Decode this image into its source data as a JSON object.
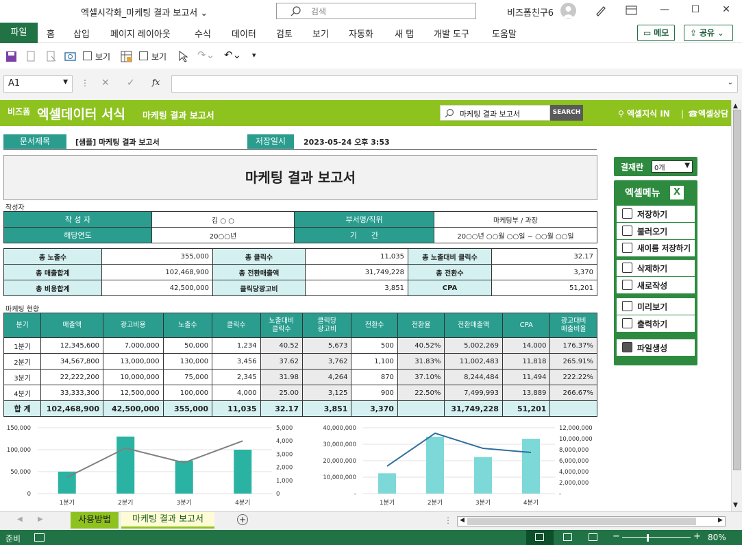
{
  "window": {
    "doc_title": "엑셀시각화_마케팅 결과 보고서",
    "search_placeholder": "검색",
    "user_name": "비즈폼친구6"
  },
  "ribbon": {
    "tabs": [
      "홈",
      "삽입",
      "페이지 레이아웃",
      "수식",
      "데이터",
      "검토",
      "보기",
      "자동화",
      "새 탭",
      "개발 도구",
      "도움말"
    ],
    "file_tab": "파일",
    "memo": "메모",
    "share": "공유"
  },
  "qat": {
    "view1": "보기",
    "view2": "보기"
  },
  "formula_bar": {
    "name_box": "A1",
    "fx": "fx"
  },
  "banner": {
    "brand_small": "비즈폼",
    "brand_big": "엑셀데이터 서식",
    "subtitle": "마케팅 결과 보고서",
    "search_value": "마케팅 결과 보고서",
    "search_button": "SEARCH",
    "link_knowledge": "엑셀지식 IN",
    "link_consult": "엑셀상담"
  },
  "doc_info": {
    "title_label": "문서제목",
    "title_value": "[샘플] 마케팅 결과 보고서",
    "saved_label": "저장일시",
    "saved_value": "2023-05-24  오후 3:53"
  },
  "report_title": "마케팅 결과 보고서",
  "author": {
    "section_label": "작성자",
    "author_label": "작 성 자",
    "author_value": "김 ○ ○",
    "dept_label": "부서명/직위",
    "dept_value": "마케팅부 / 과장",
    "year_label": "해당연도",
    "year_value": "20○○년",
    "period_label": "기      간",
    "period_value": "20○○년 ○○월 ○○일 ~ ○○월 ○○일"
  },
  "summary": [
    [
      "총 노출수",
      "355,000",
      "총 클릭수",
      "11,035",
      "총 노출대비 클릭수",
      "32.17"
    ],
    [
      "총 매출합계",
      "102,468,900",
      "총 전환매출액",
      "31,749,228",
      "총 전환수",
      "3,370"
    ],
    [
      "총 비용합계",
      "42,500,000",
      "클릭당광고비",
      "3,851",
      "CPA",
      "51,201"
    ]
  ],
  "status_section": "마케팅 현황",
  "table": {
    "headers": [
      "분기",
      "매출액",
      "광고비용",
      "노출수",
      "클릭수",
      "노출대비\n클릭수",
      "클릭당\n광고비",
      "전환수",
      "전환율",
      "전환매출액",
      "CPA",
      "광고대비\n매출비율"
    ],
    "rows": [
      [
        "1분기",
        "12,345,600",
        "7,000,000",
        "50,000",
        "1,234",
        "40.52",
        "5,673",
        "500",
        "40.52%",
        "5,002,269",
        "14,000",
        "176.37%"
      ],
      [
        "2분기",
        "34,567,800",
        "13,000,000",
        "130,000",
        "3,456",
        "37.62",
        "3,762",
        "1,100",
        "31.83%",
        "11,002,483",
        "11,818",
        "265.91%"
      ],
      [
        "3분기",
        "22,222,200",
        "10,000,000",
        "75,000",
        "2,345",
        "31.98",
        "4,264",
        "870",
        "37.10%",
        "8,244,484",
        "11,494",
        "222.22%"
      ],
      [
        "4분기",
        "33,333,300",
        "12,500,000",
        "100,000",
        "4,000",
        "25.00",
        "3,125",
        "900",
        "22.50%",
        "7,499,993",
        "13,889",
        "266.67%"
      ]
    ],
    "total": [
      "합 계",
      "102,468,900",
      "42,500,000",
      "355,000",
      "11,035",
      "32.17",
      "3,851",
      "3,370",
      "",
      "31,749,228",
      "51,201",
      ""
    ]
  },
  "side": {
    "result_label": "결재란",
    "result_value": "0개",
    "menu_title": "엑셀메뉴",
    "items": [
      "저장하기",
      "불러오기",
      "새이름 저장하기",
      "삭제하기",
      "새로작성",
      "미리보기",
      "출력하기",
      "파일생성"
    ]
  },
  "chart_data": [
    {
      "type": "bar",
      "categories": [
        "1분기",
        "2분기",
        "3분기",
        "4분기"
      ],
      "series": [
        {
          "values": [
            50000,
            130000,
            75000,
            100000
          ],
          "axis": "left",
          "kind": "bar"
        },
        {
          "values": [
            1234,
            3456,
            2345,
            4000
          ],
          "axis": "right",
          "kind": "line"
        }
      ],
      "ylim": [
        0,
        150000
      ],
      "y2lim": [
        0,
        5000
      ],
      "yticks": [
        "150,000",
        "100,000",
        "50,000",
        "0"
      ],
      "y2ticks": [
        "5,000",
        "4,000",
        "3,000",
        "2,000",
        "1,000",
        "0"
      ],
      "colors": {
        "bar": "#2ab3a3",
        "line": "#808080"
      }
    },
    {
      "type": "bar",
      "categories": [
        "1분기",
        "2분기",
        "3분기",
        "4분기"
      ],
      "series": [
        {
          "values": [
            12345600,
            34567800,
            22222200,
            33333300
          ],
          "axis": "left",
          "kind": "bar"
        },
        {
          "values": [
            5002269,
            11002483,
            8244484,
            7499993
          ],
          "axis": "right",
          "kind": "line"
        }
      ],
      "ylim": [
        0,
        40000000
      ],
      "y2lim": [
        0,
        12000000
      ],
      "yticks": [
        "40,000,000",
        "30,000,000",
        "20,000,000",
        "10,000,000",
        "-"
      ],
      "y2ticks": [
        "12,000,000",
        "10,000,000",
        "8,000,000",
        "6,000,000",
        "4,000,000",
        "2,000,000",
        "-"
      ],
      "colors": {
        "bar": "#7dd8d8",
        "line": "#2e6f9e"
      }
    }
  ],
  "sheet_tabs": [
    "사용방법",
    "마케팅 결과 보고서"
  ],
  "status": {
    "ready": "준비",
    "zoom": "80%"
  }
}
